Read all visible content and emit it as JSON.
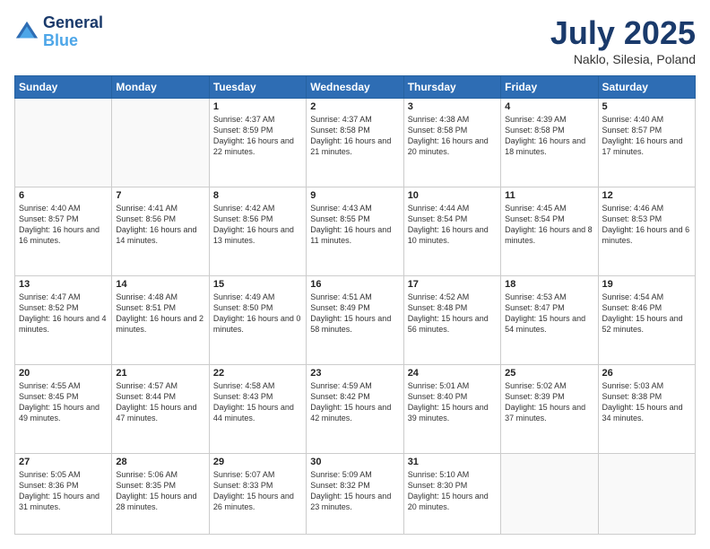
{
  "header": {
    "logo_line1": "General",
    "logo_line2": "Blue",
    "month": "July 2025",
    "location": "Naklo, Silesia, Poland"
  },
  "days_of_week": [
    "Sunday",
    "Monday",
    "Tuesday",
    "Wednesday",
    "Thursday",
    "Friday",
    "Saturday"
  ],
  "weeks": [
    [
      {
        "day": "",
        "text": ""
      },
      {
        "day": "",
        "text": ""
      },
      {
        "day": "1",
        "text": "Sunrise: 4:37 AM\nSunset: 8:59 PM\nDaylight: 16 hours\nand 22 minutes."
      },
      {
        "day": "2",
        "text": "Sunrise: 4:37 AM\nSunset: 8:58 PM\nDaylight: 16 hours\nand 21 minutes."
      },
      {
        "day": "3",
        "text": "Sunrise: 4:38 AM\nSunset: 8:58 PM\nDaylight: 16 hours\nand 20 minutes."
      },
      {
        "day": "4",
        "text": "Sunrise: 4:39 AM\nSunset: 8:58 PM\nDaylight: 16 hours\nand 18 minutes."
      },
      {
        "day": "5",
        "text": "Sunrise: 4:40 AM\nSunset: 8:57 PM\nDaylight: 16 hours\nand 17 minutes."
      }
    ],
    [
      {
        "day": "6",
        "text": "Sunrise: 4:40 AM\nSunset: 8:57 PM\nDaylight: 16 hours\nand 16 minutes."
      },
      {
        "day": "7",
        "text": "Sunrise: 4:41 AM\nSunset: 8:56 PM\nDaylight: 16 hours\nand 14 minutes."
      },
      {
        "day": "8",
        "text": "Sunrise: 4:42 AM\nSunset: 8:56 PM\nDaylight: 16 hours\nand 13 minutes."
      },
      {
        "day": "9",
        "text": "Sunrise: 4:43 AM\nSunset: 8:55 PM\nDaylight: 16 hours\nand 11 minutes."
      },
      {
        "day": "10",
        "text": "Sunrise: 4:44 AM\nSunset: 8:54 PM\nDaylight: 16 hours\nand 10 minutes."
      },
      {
        "day": "11",
        "text": "Sunrise: 4:45 AM\nSunset: 8:54 PM\nDaylight: 16 hours\nand 8 minutes."
      },
      {
        "day": "12",
        "text": "Sunrise: 4:46 AM\nSunset: 8:53 PM\nDaylight: 16 hours\nand 6 minutes."
      }
    ],
    [
      {
        "day": "13",
        "text": "Sunrise: 4:47 AM\nSunset: 8:52 PM\nDaylight: 16 hours\nand 4 minutes."
      },
      {
        "day": "14",
        "text": "Sunrise: 4:48 AM\nSunset: 8:51 PM\nDaylight: 16 hours\nand 2 minutes."
      },
      {
        "day": "15",
        "text": "Sunrise: 4:49 AM\nSunset: 8:50 PM\nDaylight: 16 hours\nand 0 minutes."
      },
      {
        "day": "16",
        "text": "Sunrise: 4:51 AM\nSunset: 8:49 PM\nDaylight: 15 hours\nand 58 minutes."
      },
      {
        "day": "17",
        "text": "Sunrise: 4:52 AM\nSunset: 8:48 PM\nDaylight: 15 hours\nand 56 minutes."
      },
      {
        "day": "18",
        "text": "Sunrise: 4:53 AM\nSunset: 8:47 PM\nDaylight: 15 hours\nand 54 minutes."
      },
      {
        "day": "19",
        "text": "Sunrise: 4:54 AM\nSunset: 8:46 PM\nDaylight: 15 hours\nand 52 minutes."
      }
    ],
    [
      {
        "day": "20",
        "text": "Sunrise: 4:55 AM\nSunset: 8:45 PM\nDaylight: 15 hours\nand 49 minutes."
      },
      {
        "day": "21",
        "text": "Sunrise: 4:57 AM\nSunset: 8:44 PM\nDaylight: 15 hours\nand 47 minutes."
      },
      {
        "day": "22",
        "text": "Sunrise: 4:58 AM\nSunset: 8:43 PM\nDaylight: 15 hours\nand 44 minutes."
      },
      {
        "day": "23",
        "text": "Sunrise: 4:59 AM\nSunset: 8:42 PM\nDaylight: 15 hours\nand 42 minutes."
      },
      {
        "day": "24",
        "text": "Sunrise: 5:01 AM\nSunset: 8:40 PM\nDaylight: 15 hours\nand 39 minutes."
      },
      {
        "day": "25",
        "text": "Sunrise: 5:02 AM\nSunset: 8:39 PM\nDaylight: 15 hours\nand 37 minutes."
      },
      {
        "day": "26",
        "text": "Sunrise: 5:03 AM\nSunset: 8:38 PM\nDaylight: 15 hours\nand 34 minutes."
      }
    ],
    [
      {
        "day": "27",
        "text": "Sunrise: 5:05 AM\nSunset: 8:36 PM\nDaylight: 15 hours\nand 31 minutes."
      },
      {
        "day": "28",
        "text": "Sunrise: 5:06 AM\nSunset: 8:35 PM\nDaylight: 15 hours\nand 28 minutes."
      },
      {
        "day": "29",
        "text": "Sunrise: 5:07 AM\nSunset: 8:33 PM\nDaylight: 15 hours\nand 26 minutes."
      },
      {
        "day": "30",
        "text": "Sunrise: 5:09 AM\nSunset: 8:32 PM\nDaylight: 15 hours\nand 23 minutes."
      },
      {
        "day": "31",
        "text": "Sunrise: 5:10 AM\nSunset: 8:30 PM\nDaylight: 15 hours\nand 20 minutes."
      },
      {
        "day": "",
        "text": ""
      },
      {
        "day": "",
        "text": ""
      }
    ]
  ]
}
